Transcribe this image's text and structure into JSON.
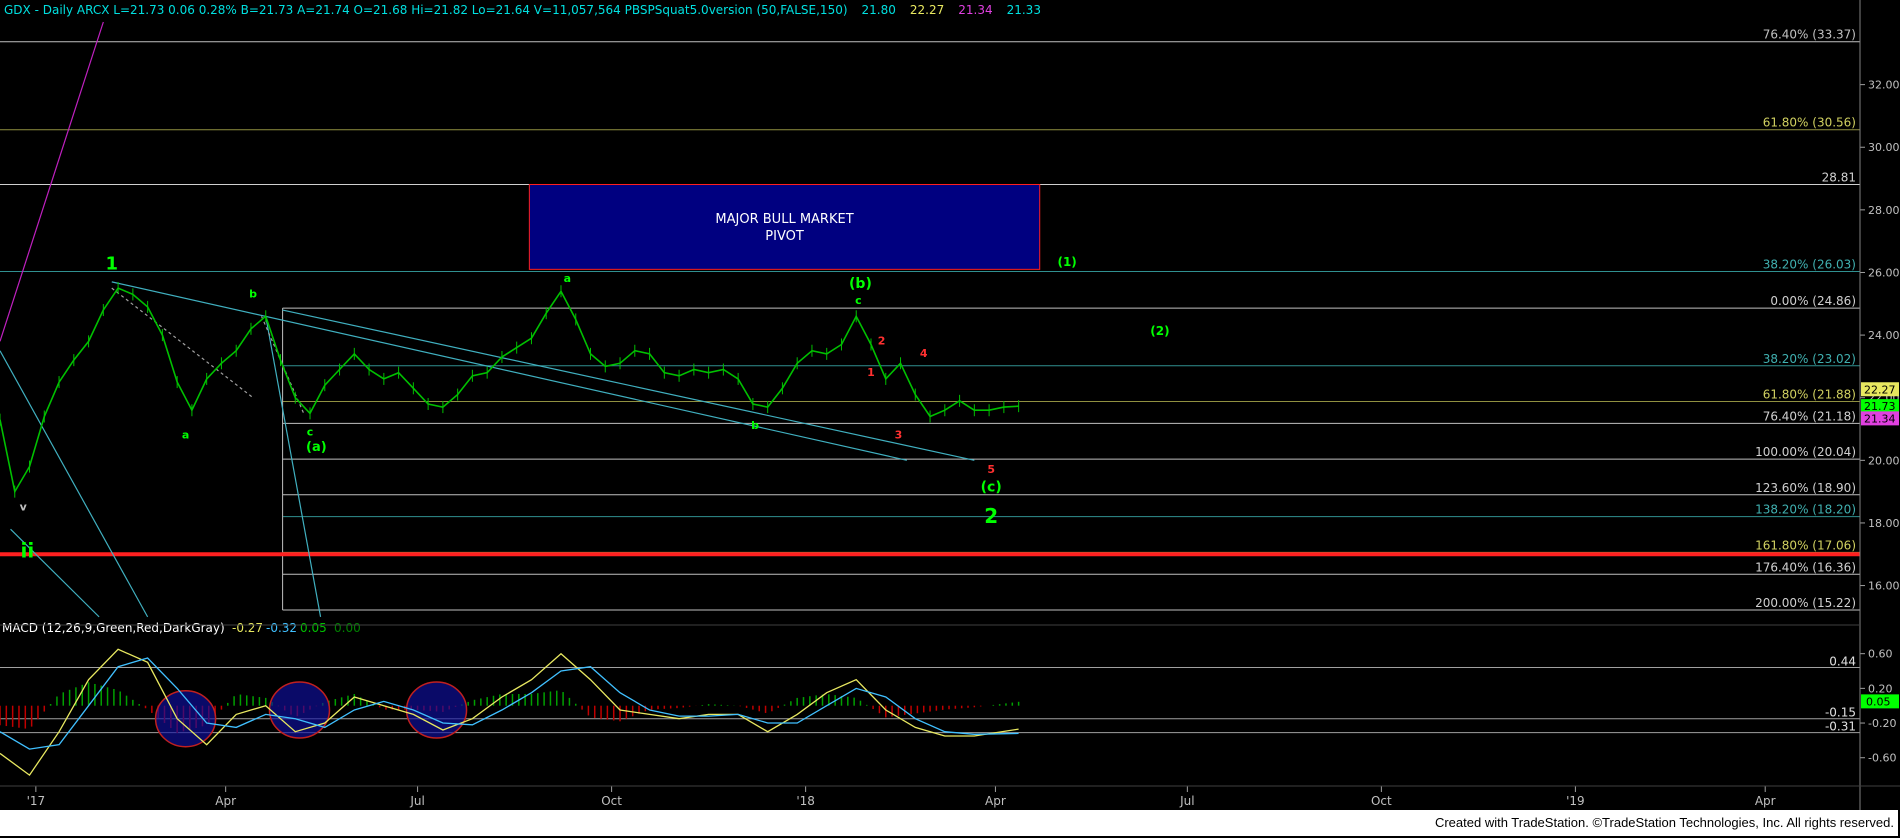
{
  "header": {
    "parts": [
      {
        "text": "GDX - Daily  ARCX  L=21.73  0.06  0.28%  B=21.73  A=21.74  O=21.68  Hi=21.82  Lo=21.64  V=11,057,564  PBSPSquat5.0version (50,FALSE,150)",
        "color": "#00e0e0"
      },
      {
        "text": "21.80",
        "color": "#00e0e0"
      },
      {
        "text": "22.27",
        "color": "#e8e860"
      },
      {
        "text": "21.34",
        "color": "#e040e0"
      },
      {
        "text": "21.33",
        "color": "#00e0e0"
      }
    ]
  },
  "footer": "Created with TradeStation. ©TradeStation Technologies, Inc. All rights reserved.",
  "colors": {
    "price": "#00c000",
    "macd": "#e8e860",
    "signal": "#40c0ff",
    "hist_pos": "#00a000",
    "hist_neg": "#c00000",
    "trend": "#40b0c0",
    "fib_line": "#c0c0c0",
    "red_line": "#ff2020",
    "pivot_fill": "#000080",
    "pivot_border": "#ff2020",
    "wave_green": "#00ff00",
    "wave_red": "#ff3030"
  },
  "chart_data": [
    {
      "type": "line",
      "title": "GDX - Daily ARCX",
      "x_tick_labels": [
        "'17",
        "Apr",
        "Jul",
        "Oct",
        "'18",
        "Apr",
        "Jul",
        "Oct",
        "'19",
        "Apr"
      ],
      "x_tick_dates": [
        "2017-01-01",
        "2017-04-01",
        "2017-07-01",
        "2017-10-01",
        "2018-01-01",
        "2018-04-01",
        "2018-07-01",
        "2018-10-01",
        "2019-01-01",
        "2019-04-01"
      ],
      "x_range": [
        "2016-12-15",
        "2019-05-15"
      ],
      "y_ticks": [
        16,
        18,
        20,
        22,
        24,
        26,
        28,
        30,
        32
      ],
      "y_tick_labels": [
        "16.00",
        "18.00",
        "20.00",
        "22.00",
        "24.00",
        "26.00",
        "28.00",
        "30.00",
        "32.00"
      ],
      "ylim": [
        14.9,
        34.0
      ],
      "series": [
        {
          "name": "GDX",
          "points": [
            [
              "2016-12-15",
              21.3
            ],
            [
              "2016-12-22",
              19.0
            ],
            [
              "2016-12-29",
              19.8
            ],
            [
              "2017-01-05",
              21.4
            ],
            [
              "2017-01-12",
              22.5
            ],
            [
              "2017-01-19",
              23.2
            ],
            [
              "2017-01-26",
              23.8
            ],
            [
              "2017-02-02",
              24.8
            ],
            [
              "2017-02-09",
              25.5
            ],
            [
              "2017-02-16",
              25.3
            ],
            [
              "2017-02-23",
              24.9
            ],
            [
              "2017-03-02",
              24.0
            ],
            [
              "2017-03-09",
              22.5
            ],
            [
              "2017-03-16",
              21.6
            ],
            [
              "2017-03-23",
              22.6
            ],
            [
              "2017-03-30",
              23.1
            ],
            [
              "2017-04-06",
              23.5
            ],
            [
              "2017-04-13",
              24.2
            ],
            [
              "2017-04-20",
              24.6
            ],
            [
              "2017-04-27",
              23.2
            ],
            [
              "2017-05-04",
              22.0
            ],
            [
              "2017-05-11",
              21.5
            ],
            [
              "2017-05-18",
              22.4
            ],
            [
              "2017-05-25",
              22.9
            ],
            [
              "2017-06-01",
              23.4
            ],
            [
              "2017-06-08",
              22.9
            ],
            [
              "2017-06-15",
              22.6
            ],
            [
              "2017-06-22",
              22.8
            ],
            [
              "2017-06-29",
              22.3
            ],
            [
              "2017-07-06",
              21.8
            ],
            [
              "2017-07-13",
              21.7
            ],
            [
              "2017-07-20",
              22.1
            ],
            [
              "2017-07-27",
              22.7
            ],
            [
              "2017-08-03",
              22.8
            ],
            [
              "2017-08-10",
              23.3
            ],
            [
              "2017-08-17",
              23.6
            ],
            [
              "2017-08-24",
              23.9
            ],
            [
              "2017-08-31",
              24.7
            ],
            [
              "2017-09-07",
              25.4
            ],
            [
              "2017-09-14",
              24.5
            ],
            [
              "2017-09-21",
              23.4
            ],
            [
              "2017-09-28",
              23.0
            ],
            [
              "2017-10-05",
              23.1
            ],
            [
              "2017-10-12",
              23.5
            ],
            [
              "2017-10-19",
              23.4
            ],
            [
              "2017-10-26",
              22.8
            ],
            [
              "2017-11-02",
              22.7
            ],
            [
              "2017-11-09",
              22.9
            ],
            [
              "2017-11-16",
              22.8
            ],
            [
              "2017-11-23",
              22.9
            ],
            [
              "2017-11-30",
              22.6
            ],
            [
              "2017-12-07",
              21.8
            ],
            [
              "2017-12-14",
              21.7
            ],
            [
              "2017-12-21",
              22.3
            ],
            [
              "2017-12-28",
              23.1
            ],
            [
              "2018-01-04",
              23.5
            ],
            [
              "2018-01-11",
              23.4
            ],
            [
              "2018-01-18",
              23.7
            ],
            [
              "2018-01-25",
              24.6
            ],
            [
              "2018-02-01",
              23.7
            ],
            [
              "2018-02-08",
              22.6
            ],
            [
              "2018-02-15",
              23.1
            ],
            [
              "2018-02-22",
              22.1
            ],
            [
              "2018-03-01",
              21.4
            ],
            [
              "2018-03-08",
              21.6
            ],
            [
              "2018-03-15",
              21.9
            ],
            [
              "2018-03-22",
              21.6
            ],
            [
              "2018-03-29",
              21.6
            ],
            [
              "2018-04-05",
              21.7
            ],
            [
              "2018-04-12",
              21.73
            ]
          ]
        }
      ],
      "horizontal_levels": [
        {
          "value": 33.37,
          "label": "76.40% (33.37)",
          "color": "#c0c0c0",
          "label_color": "#c0c0c0"
        },
        {
          "value": 30.56,
          "label": "61.80% (30.56)",
          "color": "#909040",
          "label_color": "#d0d060"
        },
        {
          "value": 28.81,
          "label": "28.81",
          "color": "#d0d0d0",
          "label_color": "#d0d0d0"
        },
        {
          "value": 26.03,
          "label": "38.20% (26.03)",
          "color": "#309090",
          "label_color": "#40b0b0"
        },
        {
          "value": 24.86,
          "label": "0.00% (24.86)",
          "color": "#c0c0c0",
          "label_color": "#d0d0d0"
        },
        {
          "value": 23.02,
          "label": "38.20% (23.02)",
          "color": "#309090",
          "label_color": "#40b0b0"
        },
        {
          "value": 21.88,
          "label": "61.80% (21.88)",
          "color": "#909040",
          "label_color": "#d0d060"
        },
        {
          "value": 21.18,
          "label": "76.40% (21.18)",
          "color": "#c0c0c0",
          "label_color": "#d0d0d0"
        },
        {
          "value": 20.04,
          "label": "100.00% (20.04)",
          "color": "#c0c0c0",
          "label_color": "#d0d0d0"
        },
        {
          "value": 18.9,
          "label": "123.60% (18.90)",
          "color": "#c0c0c0",
          "label_color": "#d0d0d0"
        },
        {
          "value": 18.2,
          "label": "138.20% (18.20)",
          "color": "#309090",
          "label_color": "#40b0b0"
        },
        {
          "value": 17.06,
          "label": "161.80% (17.06)",
          "color": "#909040",
          "label_color": "#d0d060"
        },
        {
          "value": 16.36,
          "label": "176.40% (16.36)",
          "color": "#c0c0c0",
          "label_color": "#d0d0d0"
        },
        {
          "value": 15.22,
          "label": "200.00% (15.22)",
          "color": "#c0c0c0",
          "label_color": "#d0d0d0"
        }
      ],
      "red_support": 17.0,
      "price_tags": [
        {
          "value": 22.27,
          "label": "22.27",
          "bg": "#e8e860"
        },
        {
          "value": 21.73,
          "label": "21.73",
          "bg": "#00ff00"
        },
        {
          "value": 21.34,
          "label": "21.34",
          "bg": "#e040e0"
        }
      ],
      "pivot_box": {
        "label_line1": "MAJOR BULL MARKET",
        "label_line2": "PIVOT",
        "x_start": "2017-08-23",
        "x_end": "2018-04-22",
        "y_low": 26.1,
        "y_high": 28.81
      },
      "annotations": [
        {
          "text": "1",
          "date": "2017-02-06",
          "y": 26.1,
          "color": "#00ff00",
          "size": 18
        },
        {
          "text": "b",
          "date": "2017-04-14",
          "y": 25.2,
          "color": "#00ff00",
          "size": 11
        },
        {
          "text": "a",
          "date": "2017-03-13",
          "y": 20.7,
          "color": "#00ff00",
          "size": 11
        },
        {
          "text": "c",
          "date": "2017-05-11",
          "y": 20.8,
          "color": "#00ff00",
          "size": 11
        },
        {
          "text": "(a)",
          "date": "2017-05-14",
          "y": 20.3,
          "color": "#00ff00",
          "size": 13
        },
        {
          "text": "v",
          "date": "2016-12-26",
          "y": 18.4,
          "color": "#c0c0c0",
          "size": 11
        },
        {
          "text": "ii",
          "date": "2016-12-28",
          "y": 16.9,
          "color": "#00ff00",
          "size": 20
        },
        {
          "text": "a",
          "date": "2017-09-10",
          "y": 25.7,
          "color": "#00ff00",
          "size": 11
        },
        {
          "text": "b",
          "date": "2017-12-08",
          "y": 21.0,
          "color": "#00ff00",
          "size": 11
        },
        {
          "text": "(b)",
          "date": "2018-01-27",
          "y": 25.5,
          "color": "#00ff00",
          "size": 14
        },
        {
          "text": "c",
          "date": "2018-01-26",
          "y": 25.0,
          "color": "#00ff00",
          "size": 11
        },
        {
          "text": "2",
          "date": "2018-02-06",
          "y": 23.7,
          "color": "#ff3030",
          "size": 11
        },
        {
          "text": "1",
          "date": "2018-02-01",
          "y": 22.7,
          "color": "#ff3030",
          "size": 11
        },
        {
          "text": "4",
          "date": "2018-02-26",
          "y": 23.3,
          "color": "#ff3030",
          "size": 11
        },
        {
          "text": "3",
          "date": "2018-02-14",
          "y": 20.7,
          "color": "#ff3030",
          "size": 11
        },
        {
          "text": "5",
          "date": "2018-03-30",
          "y": 19.6,
          "color": "#ff3030",
          "size": 11
        },
        {
          "text": "(c)",
          "date": "2018-03-30",
          "y": 19.0,
          "color": "#00ff00",
          "size": 14
        },
        {
          "text": "2",
          "date": "2018-03-30",
          "y": 18.0,
          "color": "#00ff00",
          "size": 20
        },
        {
          "text": "(1)",
          "date": "2018-05-05",
          "y": 26.2,
          "color": "#00ff00",
          "size": 12
        },
        {
          "text": "(2)",
          "date": "2018-06-18",
          "y": 24.0,
          "color": "#00ff00",
          "size": 12
        }
      ]
    },
    {
      "type": "line",
      "title": "MACD (12,26,9,Green,Red,DarkGray)",
      "legend_values": [
        {
          "text": "-0.27",
          "color": "#e8e860"
        },
        {
          "text": "-0.32",
          "color": "#40c0ff"
        },
        {
          "text": "0.05",
          "color": "#00c000"
        },
        {
          "text": "0.00",
          "color": "#008000"
        }
      ],
      "y_ticks": [
        0.6,
        0.2,
        -0.2,
        -0.6
      ],
      "y_tick_labels": [
        "0.60",
        "0.20",
        "-0.20",
        "-0.60"
      ],
      "ylim": [
        -0.88,
        0.85
      ],
      "levels": [
        {
          "value": 0.44,
          "label": "0.44"
        },
        {
          "value": -0.15,
          "label": "-0.15"
        },
        {
          "value": -0.31,
          "label": "-0.31"
        }
      ],
      "value_tag": {
        "value": 0.05,
        "label": "0.05",
        "bg": "#00ff00"
      },
      "series": [
        {
          "name": "MACD",
          "points": [
            [
              "2016-12-15",
              -0.55
            ],
            [
              "2016-12-29",
              -0.8
            ],
            [
              "2017-01-12",
              -0.3
            ],
            [
              "2017-01-26",
              0.3
            ],
            [
              "2017-02-09",
              0.65
            ],
            [
              "2017-02-23",
              0.5
            ],
            [
              "2017-03-09",
              -0.15
            ],
            [
              "2017-03-23",
              -0.45
            ],
            [
              "2017-04-06",
              -0.1
            ],
            [
              "2017-04-20",
              0.0
            ],
            [
              "2017-05-04",
              -0.3
            ],
            [
              "2017-05-18",
              -0.2
            ],
            [
              "2017-06-01",
              0.1
            ],
            [
              "2017-06-15",
              0.0
            ],
            [
              "2017-06-29",
              -0.1
            ],
            [
              "2017-07-13",
              -0.28
            ],
            [
              "2017-07-27",
              -0.15
            ],
            [
              "2017-08-10",
              0.1
            ],
            [
              "2017-08-24",
              0.3
            ],
            [
              "2017-09-07",
              0.6
            ],
            [
              "2017-09-21",
              0.3
            ],
            [
              "2017-10-05",
              -0.05
            ],
            [
              "2017-10-19",
              -0.1
            ],
            [
              "2017-11-02",
              -0.15
            ],
            [
              "2017-11-16",
              -0.1
            ],
            [
              "2017-11-30",
              -0.1
            ],
            [
              "2017-12-14",
              -0.3
            ],
            [
              "2017-12-28",
              -0.1
            ],
            [
              "2018-01-11",
              0.15
            ],
            [
              "2018-01-25",
              0.3
            ],
            [
              "2018-02-08",
              -0.05
            ],
            [
              "2018-02-22",
              -0.25
            ],
            [
              "2018-03-08",
              -0.35
            ],
            [
              "2018-03-22",
              -0.35
            ],
            [
              "2018-04-12",
              -0.27
            ]
          ]
        },
        {
          "name": "Signal",
          "points": [
            [
              "2016-12-15",
              -0.3
            ],
            [
              "2016-12-29",
              -0.5
            ],
            [
              "2017-01-12",
              -0.45
            ],
            [
              "2017-01-26",
              0.0
            ],
            [
              "2017-02-09",
              0.45
            ],
            [
              "2017-02-23",
              0.55
            ],
            [
              "2017-03-09",
              0.2
            ],
            [
              "2017-03-23",
              -0.2
            ],
            [
              "2017-04-06",
              -0.25
            ],
            [
              "2017-04-20",
              -0.1
            ],
            [
              "2017-05-04",
              -0.15
            ],
            [
              "2017-05-18",
              -0.25
            ],
            [
              "2017-06-01",
              -0.05
            ],
            [
              "2017-06-15",
              0.05
            ],
            [
              "2017-06-29",
              -0.05
            ],
            [
              "2017-07-13",
              -0.2
            ],
            [
              "2017-07-27",
              -0.22
            ],
            [
              "2017-08-10",
              -0.05
            ],
            [
              "2017-08-24",
              0.15
            ],
            [
              "2017-09-07",
              0.4
            ],
            [
              "2017-09-21",
              0.45
            ],
            [
              "2017-10-05",
              0.15
            ],
            [
              "2017-10-19",
              -0.05
            ],
            [
              "2017-11-02",
              -0.12
            ],
            [
              "2017-11-16",
              -0.12
            ],
            [
              "2017-11-30",
              -0.1
            ],
            [
              "2017-12-14",
              -0.2
            ],
            [
              "2017-12-28",
              -0.2
            ],
            [
              "2018-01-11",
              0.0
            ],
            [
              "2018-01-25",
              0.2
            ],
            [
              "2018-02-08",
              0.1
            ],
            [
              "2018-02-22",
              -0.15
            ],
            [
              "2018-03-08",
              -0.3
            ],
            [
              "2018-03-22",
              -0.33
            ],
            [
              "2018-04-12",
              -0.32
            ]
          ]
        }
      ],
      "circles": [
        {
          "date": "2017-03-13",
          "value": -0.15
        },
        {
          "date": "2017-05-06",
          "value": -0.05
        },
        {
          "date": "2017-07-10",
          "value": -0.05
        }
      ]
    }
  ]
}
